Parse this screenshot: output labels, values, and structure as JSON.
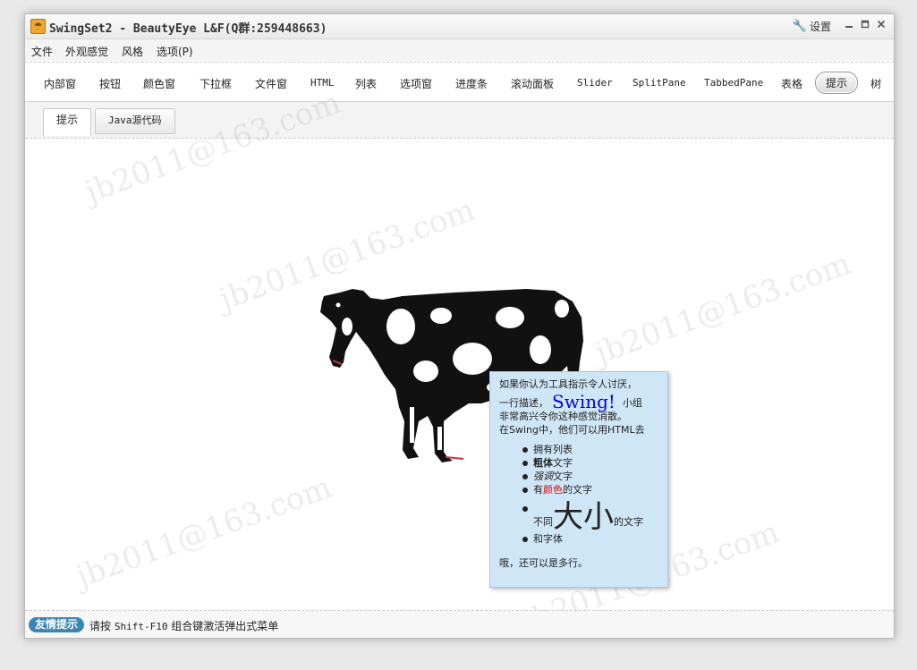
{
  "window": {
    "title": "SwingSet2 - BeautyEye L&F(Q群:259448663)",
    "settings_label": "设置"
  },
  "menubar": {
    "items": [
      "文件",
      "外观感觉",
      "风格",
      "选项(P)"
    ]
  },
  "toolbar": {
    "tabs": [
      "内部窗",
      "按钮",
      "颜色窗",
      "下拉框",
      "文件窗",
      "HTML",
      "列表",
      "选项窗",
      "进度条",
      "滚动面板",
      "Slider",
      "SplitPane",
      "TabbedPane",
      "表格",
      "提示",
      "树"
    ],
    "selected": "提示"
  },
  "subtabs": {
    "items": [
      "提示",
      "Java源代码"
    ],
    "selected": "提示"
  },
  "tooltip": {
    "line1": "如果你认为工具指示令人讨厌，",
    "line2_pre": "一行描述，",
    "swing": "Swing!",
    "line2_post": "小组",
    "line3": "非常高兴令你这种感觉消散。",
    "line4": "在Swing中，他们可以用HTML去",
    "bullet1": "拥有列表",
    "bullet2_bold": "粗体",
    "bullet2_rest": "文字",
    "bullet3_em": "强调",
    "bullet3_rest": "文字",
    "bullet4_pre": "有",
    "bullet4_red": "颜色",
    "bullet4_post": "的文字",
    "bullet5_pre": "不同",
    "bullet5_big": "大小",
    "bullet5_post": "的文字",
    "bullet6": "和字体",
    "footer": "哦，还可以是多行。"
  },
  "watermark": "jb2011@163.com",
  "statusbar": {
    "badge": "友情提示",
    "text_pre": "请按",
    "keys": "Shift-F10",
    "text_post": "组合键激活弹出式菜单"
  },
  "colors": {
    "tooltip_bg": "#cfe6f7",
    "badge_bg": "#3a86b5",
    "swing_text": "#0000e8",
    "red_text": "#e10000"
  },
  "icons": [
    "app-icon",
    "wrench-icon",
    "minimize-icon",
    "maximize-icon",
    "close-icon"
  ]
}
